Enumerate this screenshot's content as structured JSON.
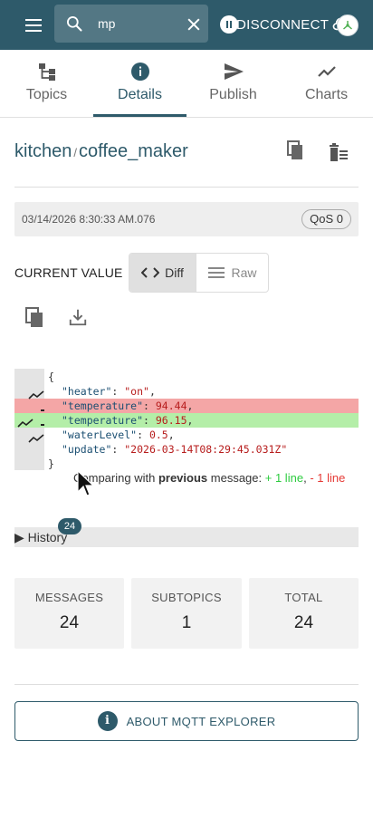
{
  "appbar": {
    "search": {
      "value": "mp",
      "placeholder": "Search"
    },
    "disconnect_label": "DISCONNECT"
  },
  "tabs": [
    {
      "label": "Topics",
      "icon": "topics-icon"
    },
    {
      "label": "Details",
      "icon": "info-icon",
      "active": true
    },
    {
      "label": "Publish",
      "icon": "send-icon"
    },
    {
      "label": "Charts",
      "icon": "chart-icon"
    }
  ],
  "topic": {
    "parent": "kitchen",
    "separator": "/",
    "name": "coffee_maker"
  },
  "message": {
    "timestamp": "03/14/2026 8:30:33 AM.076",
    "qos": "QoS 0"
  },
  "current_value": {
    "label": "CURRENT VALUE",
    "diff_label": "Diff",
    "raw_label": "Raw",
    "selected": "Diff"
  },
  "diff": {
    "lines": [
      {
        "type": "context",
        "text": "{"
      },
      {
        "type": "context",
        "key": "\"heater\"",
        "value": "\"on\"",
        "tail": ","
      },
      {
        "type": "removed",
        "key": "\"temperature\"",
        "value": "94.44",
        "tail": ","
      },
      {
        "type": "added",
        "key": "\"temperature\"",
        "value": "96.15",
        "tail": ","
      },
      {
        "type": "context",
        "key": "\"waterLevel\"",
        "value": "0.5",
        "tail": ","
      },
      {
        "type": "context",
        "key": "\"update\"",
        "value": "\"2026-03-14T08:29:45.031Z\"",
        "tail": ""
      },
      {
        "type": "context",
        "text": "}"
      }
    ],
    "summary": {
      "prefix": "Comparing with",
      "bold": "previous",
      "middle": "message:",
      "added": "+ 1 line",
      "sep": ",",
      "removed": "- 1 line"
    }
  },
  "history": {
    "label": "▶ History",
    "count": "24"
  },
  "stats": {
    "messages": {
      "label": "MESSAGES",
      "value": "24"
    },
    "subtopics": {
      "label": "SUBTOPICS",
      "value": "1"
    },
    "total": {
      "label": "TOTAL",
      "value": "24"
    }
  },
  "about_label": "ABOUT MQTT EXPLORER",
  "colors": {
    "primary": "#2e5a6a",
    "removed_bg": "#f4a6a6",
    "added_bg": "#b4eea8",
    "diff_plus": "#2ecc40",
    "diff_minus": "#e53935"
  }
}
